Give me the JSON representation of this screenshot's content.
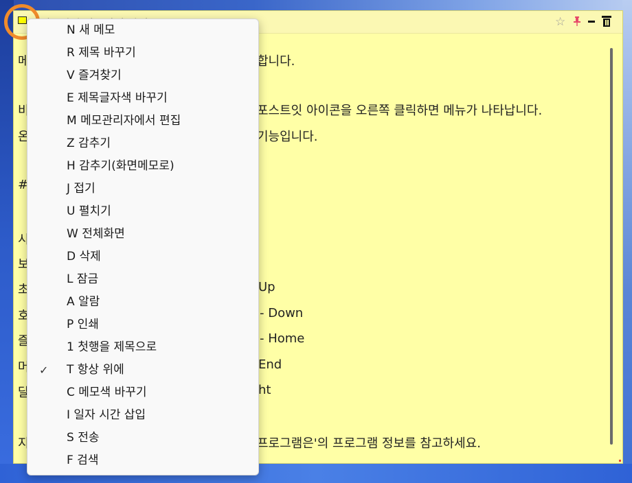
{
  "note": {
    "title": "메모장의 사용방법 안내",
    "lines": [
      {
        "prefix": "메",
        "text": "합니다."
      },
      {
        "prefix": "비",
        "text": "포스트잇 아이콘을 오른쪽 클릭하면 메뉴가 나타납니다."
      },
      {
        "prefix": "온",
        "text": "기능입니다."
      },
      {
        "prefix": "#",
        "text": ""
      },
      {
        "prefix": "시",
        "text": ""
      },
      {
        "prefix": "보",
        "text": ""
      },
      {
        "prefix": "초",
        "text": "Up"
      },
      {
        "prefix": "호",
        "text": "- Down"
      },
      {
        "prefix": "즐",
        "text": "- Home"
      },
      {
        "prefix": "머",
        "text": "End"
      },
      {
        "prefix": "달",
        "text": "ht"
      },
      {
        "prefix": "지",
        "text": "프로그램은'의 프로그램 정보를 참고하세요."
      }
    ]
  },
  "titlebar_icons": {
    "star": "☆",
    "pin": "📌"
  },
  "context_menu": {
    "items": [
      {
        "label": "N 새 메모",
        "checked": false
      },
      {
        "label": "R 제목 바꾸기",
        "checked": false
      },
      {
        "label": "V 즐겨찾기",
        "checked": false
      },
      {
        "label": "E 제목글자색 바꾸기",
        "checked": false
      },
      {
        "label": "M 메모관리자에서 편집",
        "checked": false
      },
      {
        "label": "Z 감추기",
        "checked": false
      },
      {
        "label": "H 감추기(화면메모로)",
        "checked": false
      },
      {
        "label": "J 접기",
        "checked": false
      },
      {
        "label": "U 펼치기",
        "checked": false
      },
      {
        "label": "W 전체화면",
        "checked": false
      },
      {
        "label": "D 삭제",
        "checked": false
      },
      {
        "label": "L 잠금",
        "checked": false
      },
      {
        "label": "A 알람",
        "checked": false
      },
      {
        "label": "P 인쇄",
        "checked": false
      },
      {
        "label": "1 첫행을 제목으로",
        "checked": false
      },
      {
        "label": "T 항상 위에",
        "checked": true
      },
      {
        "label": "C 메모색 바꾸기",
        "checked": false
      },
      {
        "label": "I 일자 시간 삽입",
        "checked": false
      },
      {
        "label": "S 전송",
        "checked": false
      },
      {
        "label": "F 검색",
        "checked": false
      }
    ],
    "check_glyph": "✓"
  },
  "colors": {
    "note_bg": "#ffffa6",
    "highlight": "#f18b2b"
  }
}
